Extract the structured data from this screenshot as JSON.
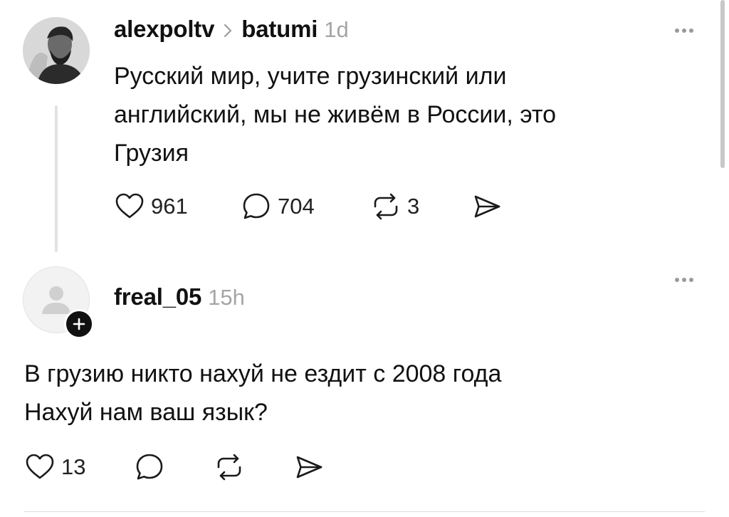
{
  "posts": [
    {
      "username": "alexpoltv",
      "community": "batumi",
      "time": "1d",
      "text_lines": [
        "Русский мир, учите грузинский или",
        "английский, мы не живём в России, это",
        "Грузия"
      ],
      "likes": "961",
      "replies": "704",
      "reposts": "3"
    },
    {
      "username": "freal_05",
      "time": "15h",
      "text_lines": [
        "В грузию никто нахуй не ездит с 2008 года",
        "Нахуй нам ваш язык?"
      ],
      "likes": "13"
    }
  ],
  "icons": {
    "more": "more-horizontal-icon",
    "like": "heart-icon",
    "reply": "comment-bubble-icon",
    "repost": "repost-icon",
    "share": "send-icon",
    "follow": "plus-icon",
    "separator": "chevron-right-icon"
  },
  "colors": {
    "text": "#111111",
    "muted": "#a5a5a5",
    "icon": "#1a1a1a",
    "divider": "#dedede"
  }
}
